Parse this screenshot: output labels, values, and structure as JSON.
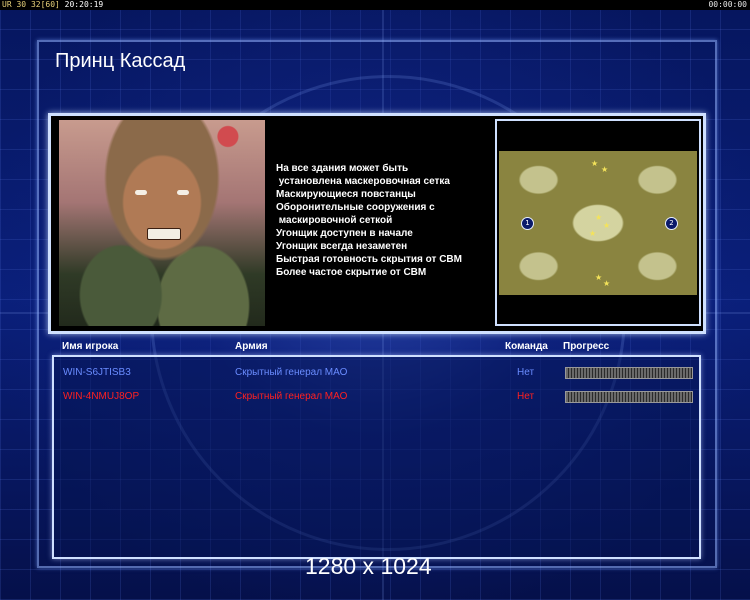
{
  "hud": {
    "left_tag": "UR",
    "left_value1": "30",
    "left_value2": "32",
    "left_value3": "[60]",
    "clock": "20:20:19",
    "timer": "00:00:00"
  },
  "title": "Принц Кассад",
  "features": [
    "На все здания может быть",
    " установлена маскеровочная сетка",
    "Маскирующиеся повстанцы",
    "Оборонительные сооружения с",
    " маскировочной сеткой",
    "Угонщик доступен в начале",
    "Угонщик всегда незаметен",
    "Быстрая готовность скрытия от СВМ",
    "Более частое скрытие от СВМ"
  ],
  "minimap": {
    "markers": [
      "1",
      "2"
    ]
  },
  "table": {
    "headers": {
      "player": "Имя игрока",
      "army": "Армия",
      "team": "Команда",
      "progress": "Прогресс"
    },
    "rows": [
      {
        "player": "WIN-S6JTISB3",
        "army": "Скрытный генерал МАО",
        "team": "Нет",
        "color": "#6a8cff",
        "progress": 1.0
      },
      {
        "player": "WIN-4NMUJ8OP",
        "army": "Скрытный генерал МАО",
        "team": "Нет",
        "color": "#ff2020",
        "progress": 1.0
      }
    ]
  },
  "resolution": "1280 x 1024"
}
